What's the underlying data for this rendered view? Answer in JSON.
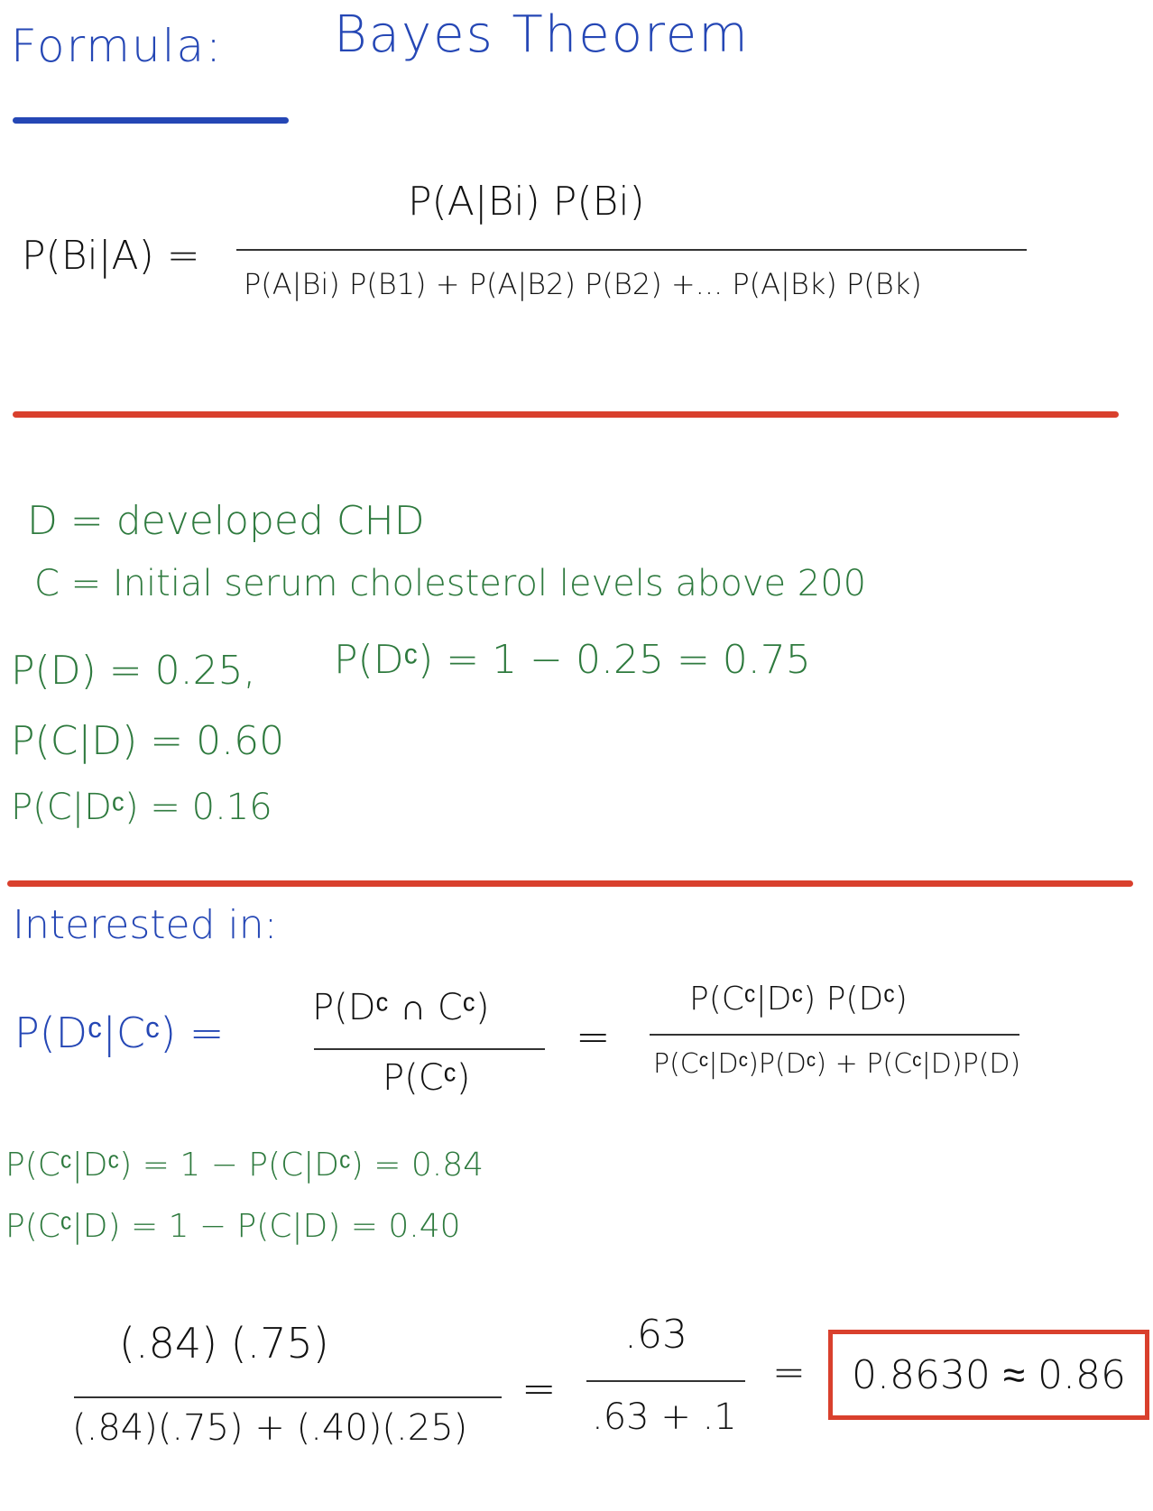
{
  "header": {
    "label": "Formula:",
    "title": "Bayes Theorem"
  },
  "formula": {
    "lhs": "P(Bi|A) =",
    "numerator": "P(A|Bi) P(Bi)",
    "denominator": "P(A|Bi) P(B1) + P(A|B2) P(B2) +... P(A|Bk) P(Bk)"
  },
  "given": {
    "def_d": "D = developed CHD",
    "def_c": "C = Initial serum cholesterol levels above 200",
    "p_d": "P(D) = 0.25,",
    "p_dc": "P(Dᶜ) = 1 − 0.25 = 0.75",
    "p_c_given_d": "P(C|D) = 0.60",
    "p_c_given_dc": "P(C|Dᶜ) = 0.16"
  },
  "interest": {
    "label": "Interested in:",
    "lhs": "P(Dᶜ|Cᶜ) =",
    "frac1_num": "P(Dᶜ ∩ Cᶜ)",
    "frac1_den": "P(Cᶜ)",
    "equals": "=",
    "frac2_num": "P(Cᶜ|Dᶜ) P(Dᶜ)",
    "frac2_den": "P(Cᶜ|Dᶜ)P(Dᶜ) + P(Cᶜ|D)P(D)"
  },
  "complements": {
    "line1": "P(Cᶜ|Dᶜ) = 1 − P(C|Dᶜ) = 0.84",
    "line2": "P(Cᶜ|D) = 1 − P(C|D) = 0.40"
  },
  "calculation": {
    "num": "(.84) (.75)",
    "den": "(.84)(.75) + (.40)(.25)",
    "eq1": "=",
    "num2": ".63",
    "den2": ".63 + .1",
    "eq2": "=",
    "result": "0.8630 ≈ 0.86"
  },
  "colors": {
    "blue": "#2547b5",
    "green": "#2e7a3e",
    "red": "#d9402d",
    "black": "#111111"
  }
}
